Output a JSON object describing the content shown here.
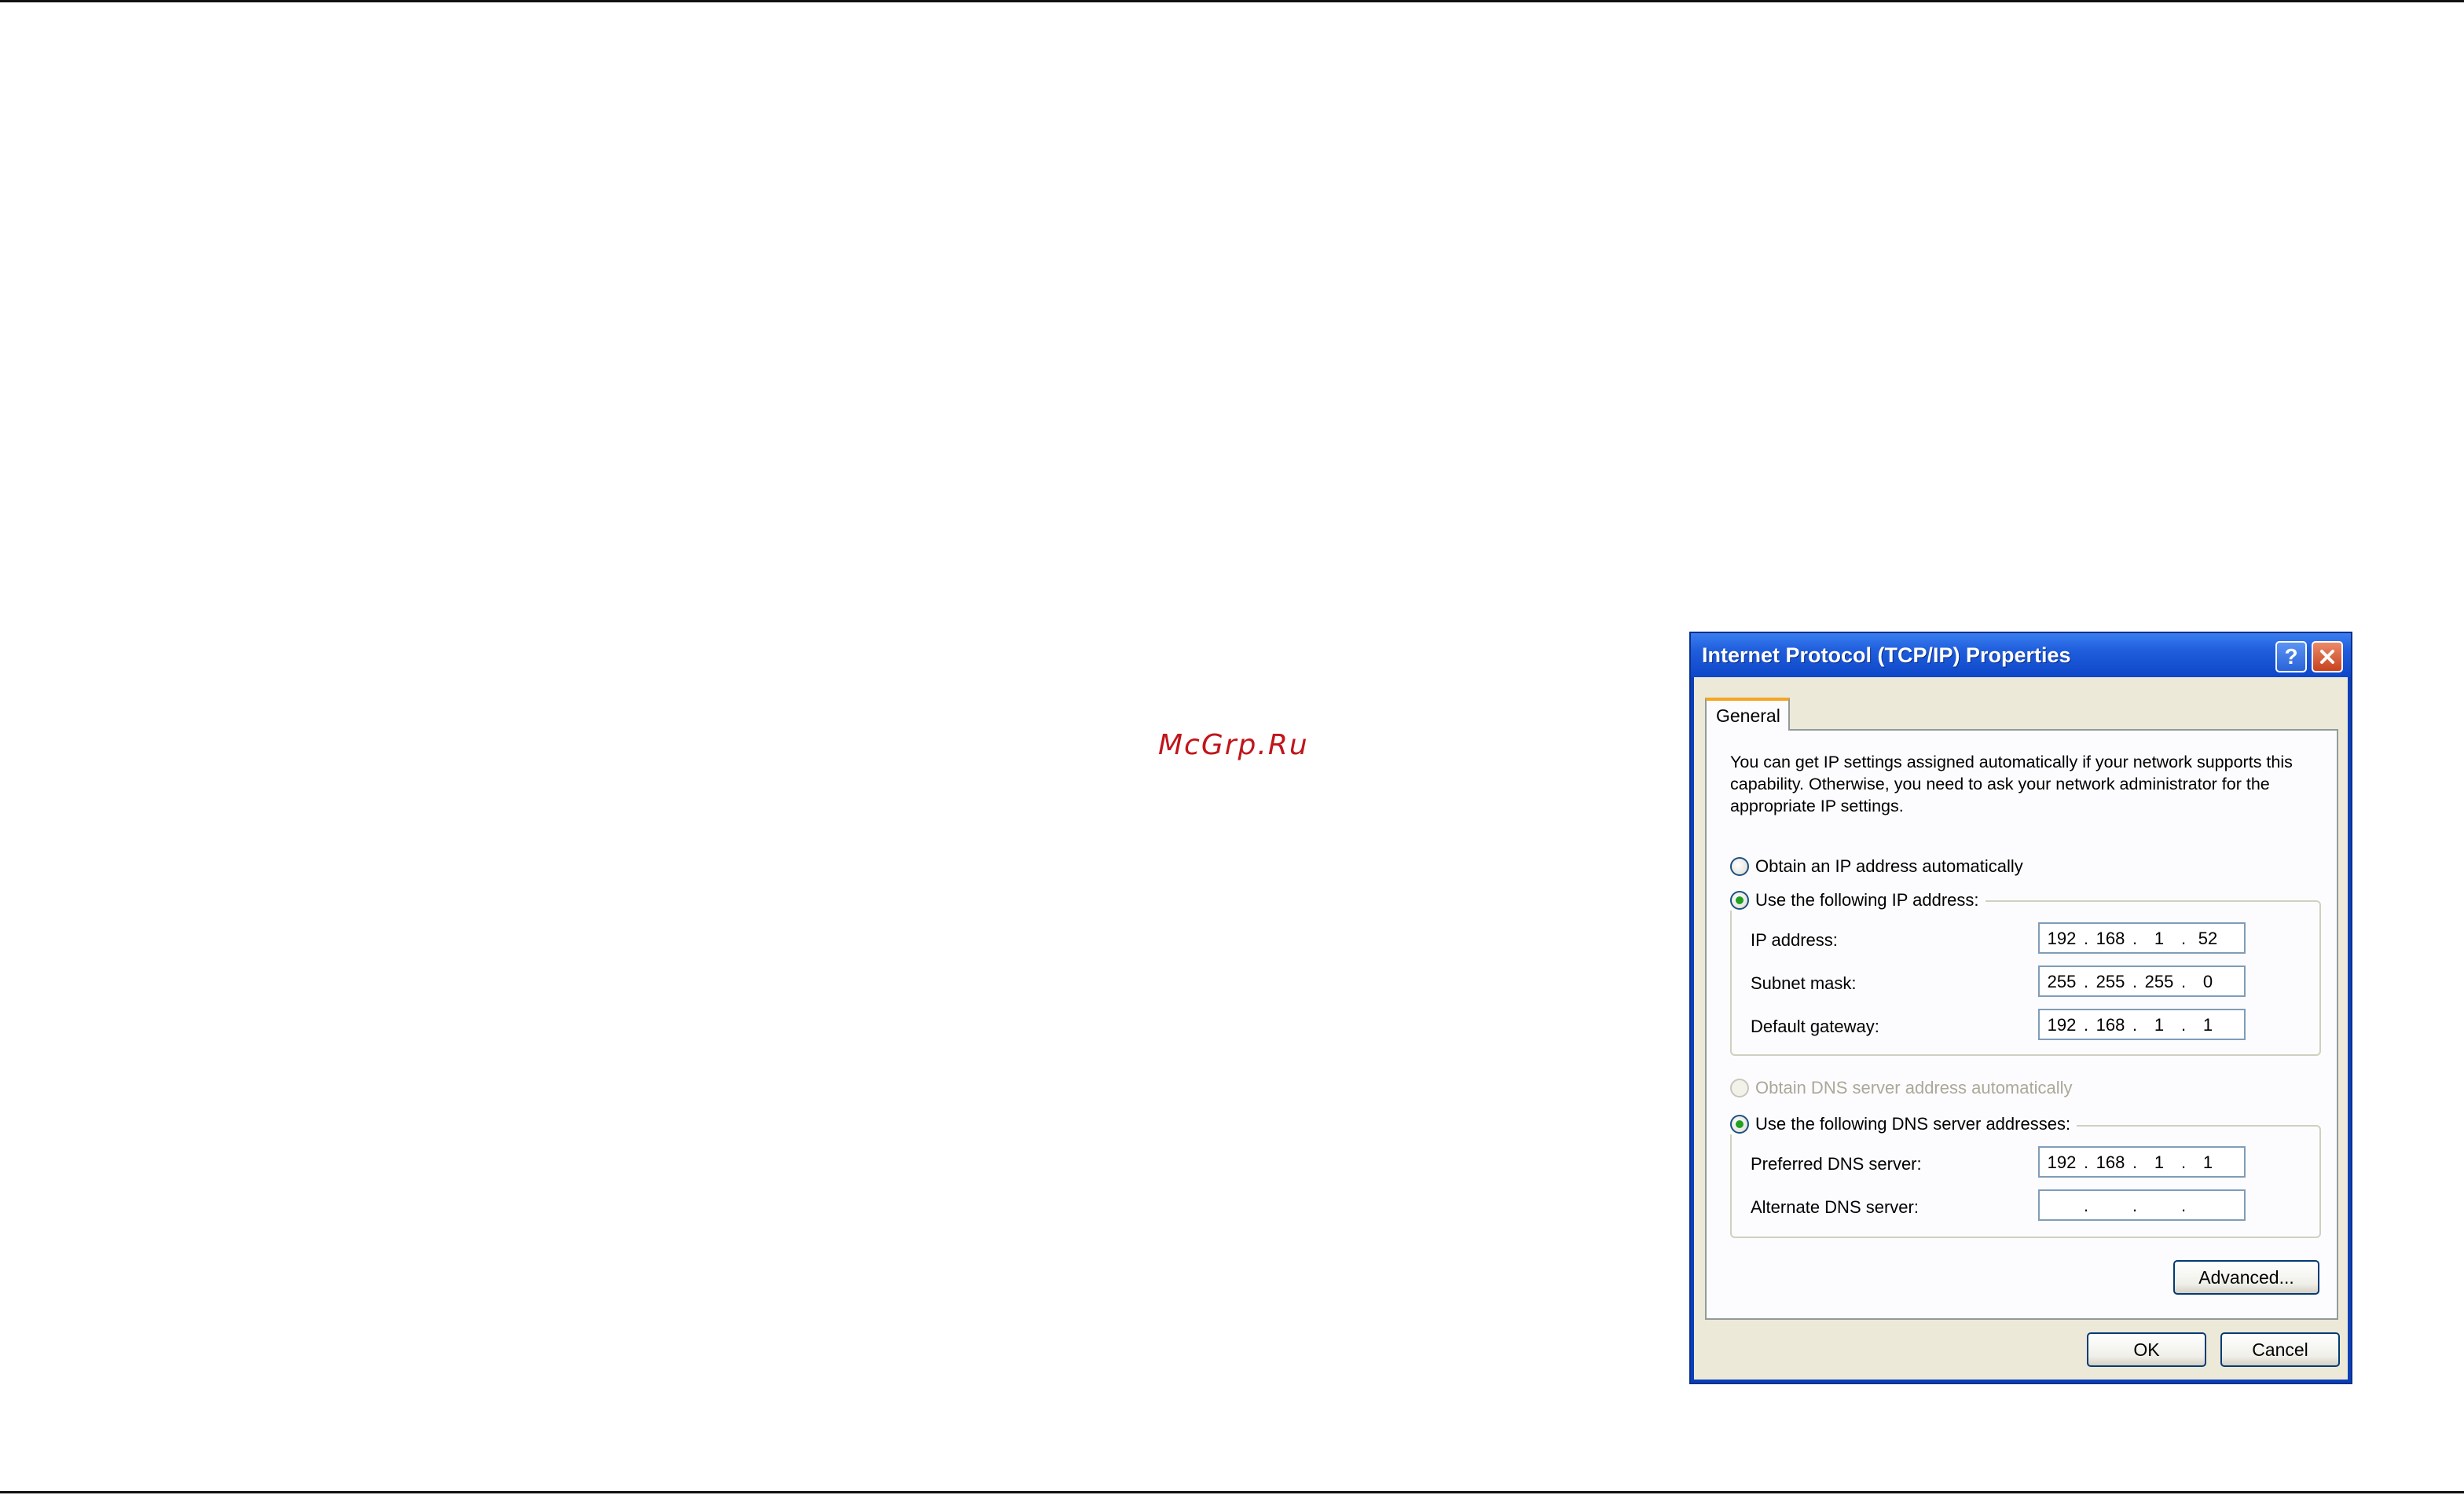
{
  "watermark": "McGrp.Ru",
  "dialog": {
    "title": "Internet Protocol (TCP/IP) Properties",
    "help_symbol": "?",
    "tab_general": "General",
    "description": "You can get IP settings assigned automatically if your network supports this capability. Otherwise, you need to ask your network administrator for the appropriate IP settings.",
    "ip_mode": {
      "auto_label": "Obtain an IP address automatically",
      "manual_label": "Use the following IP address:",
      "selected": "manual"
    },
    "ip_fields": {
      "ip_label": "IP address:",
      "ip_value": [
        "192",
        "168",
        "1",
        "52"
      ],
      "mask_label": "Subnet mask:",
      "mask_value": [
        "255",
        "255",
        "255",
        "0"
      ],
      "gateway_label": "Default gateway:",
      "gateway_value": [
        "192",
        "168",
        "1",
        "1"
      ]
    },
    "dns_mode": {
      "auto_label": "Obtain DNS server address automatically",
      "manual_label": "Use the following DNS server addresses:",
      "selected": "manual"
    },
    "dns_fields": {
      "preferred_label": "Preferred DNS server:",
      "preferred_value": [
        "192",
        "168",
        "1",
        "1"
      ],
      "alternate_label": "Alternate DNS server:",
      "alternate_value": [
        "",
        "",
        "",
        ""
      ]
    },
    "advanced_button": "Advanced...",
    "ok_button": "OK",
    "cancel_button": "Cancel"
  },
  "colors": {
    "title_bar": "#1f5ddc",
    "dialog_face": "#ece9d8",
    "tab_highlight": "#f5a524",
    "watermark": "#c0161b",
    "radio_selected": "#21a121"
  }
}
